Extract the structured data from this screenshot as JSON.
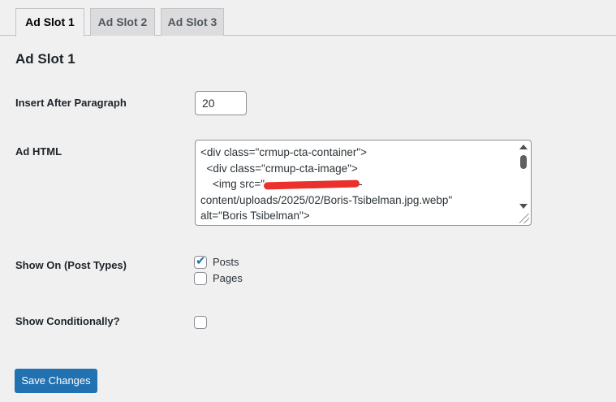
{
  "tabs": [
    {
      "label": "Ad Slot 1",
      "active": true
    },
    {
      "label": "Ad Slot 2",
      "active": false
    },
    {
      "label": "Ad Slot 3",
      "active": false
    }
  ],
  "section": {
    "title": "Ad Slot 1"
  },
  "insert_after": {
    "label": "Insert After Paragraph",
    "value": "20"
  },
  "ad_html": {
    "label": "Ad HTML",
    "lines": [
      "<div class=\"crmup-cta-container\">",
      "  <div class=\"crmup-cta-image\">",
      "    <img src=\"",
      "-",
      "content/uploads/2025/02/Boris-Tsibelman.jpg.webp\"",
      "alt=\"Boris Tsibelman\">"
    ],
    "redaction_color": "#e8201a"
  },
  "post_types": {
    "label": "Show On (Post Types)",
    "options": [
      {
        "label": "Posts",
        "checked": true
      },
      {
        "label": "Pages",
        "checked": false
      }
    ]
  },
  "conditional": {
    "label": "Show Conditionally?",
    "checked": false
  },
  "save_button": {
    "label": "Save Changes"
  },
  "colors": {
    "accent": "#2271b1",
    "background": "#f0f0f1",
    "tab_inactive": "#dcdcde"
  }
}
